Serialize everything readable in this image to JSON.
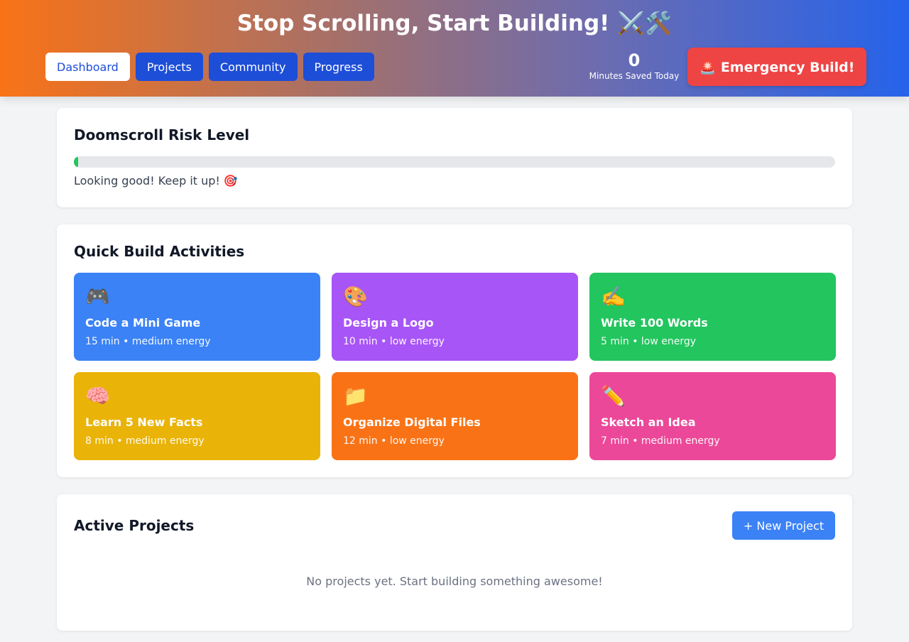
{
  "header": {
    "title": "Stop Scrolling, Start Building! ⚔️🛠️",
    "nav": [
      {
        "label": "Dashboard",
        "active": true
      },
      {
        "label": "Projects",
        "active": false
      },
      {
        "label": "Community",
        "active": false
      },
      {
        "label": "Progress",
        "active": false
      }
    ],
    "minutes_saved_value": "0",
    "minutes_saved_label": "Minutes Saved Today",
    "emergency_label": "🚨 Emergency Build!"
  },
  "risk": {
    "heading": "Doomscroll Risk Level",
    "level_percent": 0.6,
    "bar_color": "#22c55e",
    "message": "Looking good! Keep it up! 🎯"
  },
  "quick": {
    "heading": "Quick Build Activities",
    "activities": [
      {
        "icon": "🎮",
        "icon_name": "game-controller-icon",
        "name": "Code a Mini Game",
        "meta": "15 min • medium energy",
        "color": "#3b82f6"
      },
      {
        "icon": "🎨",
        "icon_name": "palette-icon",
        "name": "Design a Logo",
        "meta": "10 min • low energy",
        "color": "#a855f7"
      },
      {
        "icon": "✍️",
        "icon_name": "writing-hand-icon",
        "name": "Write 100 Words",
        "meta": "5 min • low energy",
        "color": "#22c55e"
      },
      {
        "icon": "🧠",
        "icon_name": "brain-icon",
        "name": "Learn 5 New Facts",
        "meta": "8 min • medium energy",
        "color": "#eab308"
      },
      {
        "icon": "📁",
        "icon_name": "folder-icon",
        "name": "Organize Digital Files",
        "meta": "12 min • low energy",
        "color": "#f97316"
      },
      {
        "icon": "✏️",
        "icon_name": "pencil-icon",
        "name": "Sketch an Idea",
        "meta": "7 min • medium energy",
        "color": "#ec4899"
      }
    ]
  },
  "projects": {
    "heading": "Active Projects",
    "new_label": "+ New Project",
    "empty_message": "No projects yet. Start building something awesome!"
  }
}
